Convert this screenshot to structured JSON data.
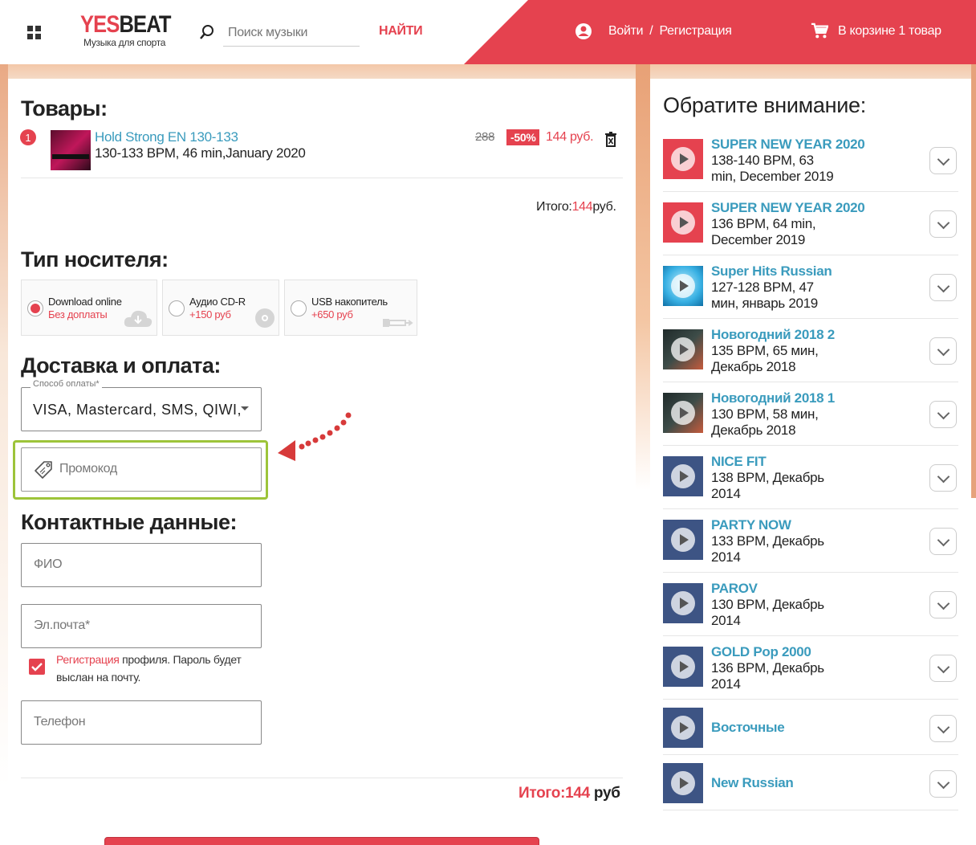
{
  "header": {
    "logo_yes": "YES",
    "logo_beat": "BEAT",
    "tagline": "Музыка для спорта",
    "search_placeholder": "Поиск музыки",
    "search_button": "НАЙТИ",
    "login": "Войти",
    "login_sep": "/",
    "register": "Регистрация",
    "cart": "В корзине 1 товар"
  },
  "goods": {
    "heading": "Товары:",
    "items": [
      {
        "number": "1",
        "title": "Hold Strong EN 130-133",
        "meta": "130-133 BPM, 46 min,January 2020",
        "old_price": "288",
        "discount": "-50%",
        "price": "144 руб."
      }
    ],
    "subtotal_label": "Итого:",
    "subtotal_value": "144",
    "subtotal_currency": "руб."
  },
  "media": {
    "heading": "Тип носителя:",
    "options": [
      {
        "label": "Download online",
        "sub": "Без доплаты",
        "selected": true,
        "icon": "cloud-download-icon"
      },
      {
        "label": "Аудио CD-R",
        "sub": "+150 руб",
        "selected": false,
        "icon": "disc-icon"
      },
      {
        "label": "USB накопитель",
        "sub": "+650 руб",
        "selected": false,
        "icon": "usb-icon"
      }
    ]
  },
  "delivery": {
    "heading": "Доставка и оплата:",
    "payment_label": "Способ оплаты*",
    "payment_value": "VISA, Mastercard, SMS, QIWI,",
    "promo_placeholder": "Промокод"
  },
  "contacts": {
    "heading": "Контактные данные:",
    "name_placeholder": "ФИО",
    "email_placeholder": "Эл.почта*",
    "register_link": "Регистрация",
    "register_text": " профиля. Пароль будет выслан на почту.",
    "register_checked": true,
    "phone_placeholder": "Телефон"
  },
  "total": {
    "label": "Итого:",
    "value": "144",
    "currency": "руб"
  },
  "sidebar": {
    "title": "Обратите внимание:",
    "items": [
      {
        "title": "SUPER NEW YEAR 2020",
        "meta": "138-140 BPM, 63 min, December 2019",
        "cover": "red"
      },
      {
        "title": "SUPER NEW YEAR 2020",
        "meta": "136 BPM, 64 min, December 2019",
        "cover": "red"
      },
      {
        "title": "Super Hits Russian",
        "meta": "127-128 BPM, 47 мин, январь 2019",
        "cover": "blue"
      },
      {
        "title": "Новогодний 2018 2",
        "meta": "135 BPM, 65 мин, Декабрь 2018",
        "cover": "dark"
      },
      {
        "title": "Новогодний 2018 1",
        "meta": "130 BPM, 58 мин, Декабрь 2018",
        "cover": "dark"
      },
      {
        "title": "NICE FIT",
        "meta": "138 BPM, Декабрь 2014",
        "cover": "heart"
      },
      {
        "title": "PARTY NOW",
        "meta": "133 BPM, Декабрь 2014",
        "cover": "heart"
      },
      {
        "title": "PAROV",
        "meta": "130 BPM, Декабрь 2014",
        "cover": "heart"
      },
      {
        "title": "GOLD Pop 2000",
        "meta": "136 BPM, Декабрь 2014",
        "cover": "heart"
      },
      {
        "title": "Восточные",
        "meta": "",
        "cover": "heart"
      },
      {
        "title": "New Russian",
        "meta": "",
        "cover": "heart"
      }
    ]
  },
  "colors": {
    "accent": "#e5424f",
    "link": "#3a9bbd",
    "promo_highlight": "#9dc43a"
  }
}
